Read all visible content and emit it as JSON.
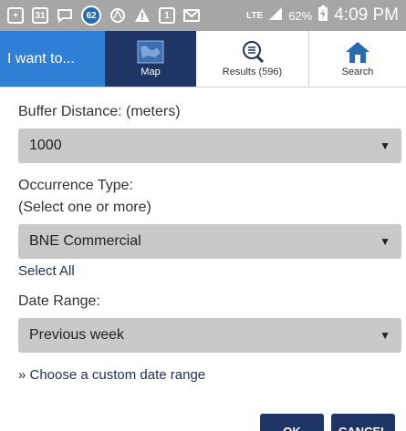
{
  "status_bar": {
    "battery": "62%",
    "network": "LTE",
    "time": "4:09 PM",
    "notification_icons": [
      "plus-icon",
      "calendar-icon",
      "chat-icon",
      "badge-62-icon",
      "maps-icon",
      "warning-icon",
      "calendar-1-icon",
      "mail-icon"
    ],
    "badge_count": "62",
    "calendar_day": "31",
    "calendar_day2": "1"
  },
  "topnav": {
    "i_want_label": "I want to...",
    "map_label": "Map",
    "results_label": "Results (596)",
    "search_label": "Search"
  },
  "form": {
    "buffer_label": "Buffer Distance: (meters)",
    "buffer_value": "1000",
    "occurrence_label": "Occurrence Type:",
    "occurrence_hint": "(Select one or more)",
    "occurrence_value": "BNE Commercial",
    "select_all_label": "Select All",
    "date_label": "Date Range:",
    "date_value": "Previous week",
    "custom_date_link": "» Choose a custom date range"
  },
  "buttons": {
    "ok_label": "OK",
    "cancel_label": "CANCEL"
  },
  "colors": {
    "accent_blue": "#2f7fd6",
    "navy": "#1f3566",
    "select_bg": "#c9c9c9",
    "statusbar_bg": "#a6a6a6"
  }
}
